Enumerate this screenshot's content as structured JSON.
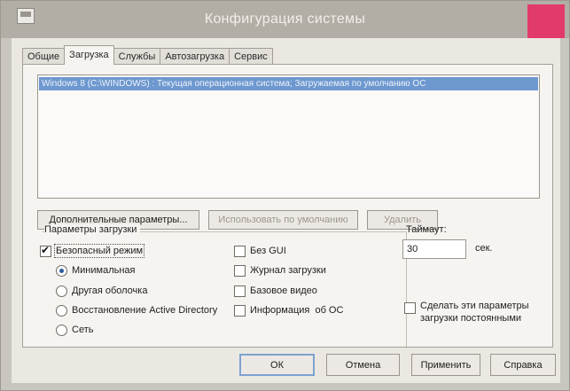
{
  "window": {
    "title": "Конфигурация системы"
  },
  "tabs": [
    {
      "label": "Общие"
    },
    {
      "label": "Загрузка"
    },
    {
      "label": "Службы"
    },
    {
      "label": "Автозагрузка"
    },
    {
      "label": "Сервис"
    }
  ],
  "boot_list": {
    "selected_item": "Windows 8 (C:\\WINDOWS) : Текущая операционная система; Загружаемая по умолчанию ОС"
  },
  "list_buttons": {
    "advanced": "Дополнительные параметры...",
    "set_default": "Использовать по умолчанию",
    "delete": "Удалить"
  },
  "boot_options": {
    "title": "Параметры загрузки",
    "safe_boot": {
      "label": "Безопасный режим",
      "checked": true
    },
    "modes": [
      {
        "label": "Минимальная",
        "checked": true
      },
      {
        "label": "Другая оболочка",
        "checked": false
      },
      {
        "label": "Восстановление Active Directory",
        "checked": false
      },
      {
        "label": "Сеть",
        "checked": false
      }
    ],
    "options": [
      {
        "label": "Без GUI",
        "checked": false
      },
      {
        "label": "Журнал загрузки",
        "checked": false
      },
      {
        "label": "Базовое видео",
        "checked": false
      },
      {
        "label": "Информация  об ОС",
        "checked": false
      }
    ]
  },
  "timeout": {
    "label": "Таймаут:",
    "value": "30",
    "unit": "сек."
  },
  "permanent": {
    "label_line1": "Сделать эти параметры",
    "label_line2": "загрузки постоянными",
    "checked": false
  },
  "footer": {
    "ok": "ОК",
    "cancel": "Отмена",
    "apply": "Применить",
    "help": "Справка"
  },
  "colors": {
    "selection": "#6d98d0",
    "close_button": "#e23b6b",
    "accent_border": "#7ea2cf"
  }
}
